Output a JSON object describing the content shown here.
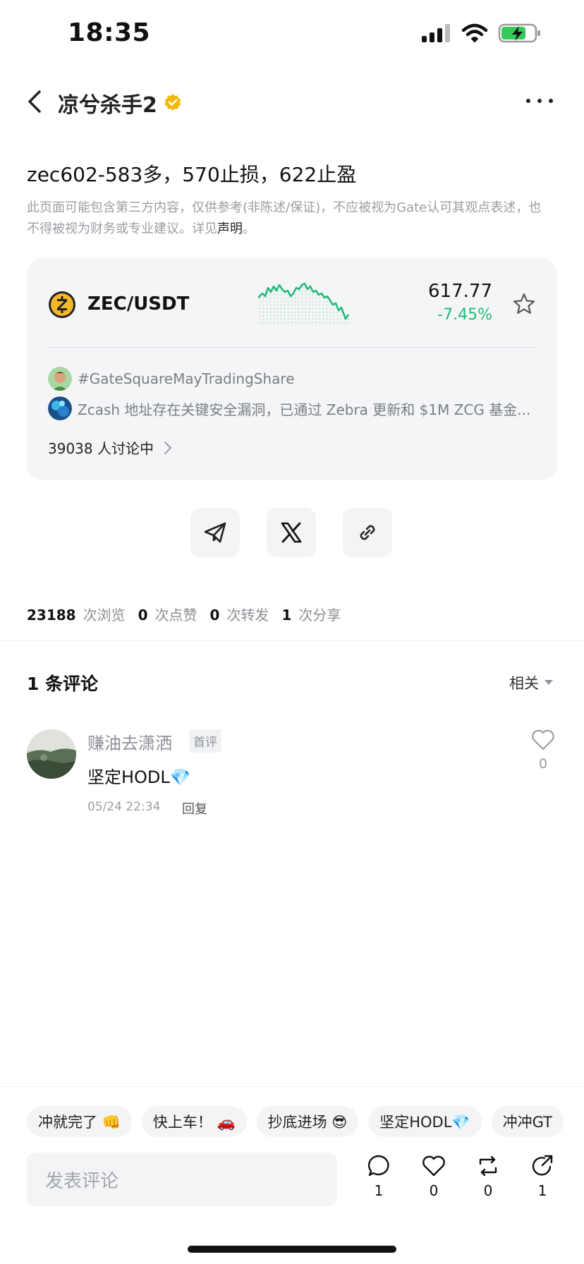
{
  "status_bar": {
    "time": "18:35"
  },
  "header": {
    "author": "凉兮杀手2"
  },
  "post": {
    "title": "zec602-583多，570止损，622止盈",
    "disclaimer": "此页面可能包含第三方内容，仅供参考(非陈述/保证)，不应被视为Gate认可其观点表述，也不得被视为财务或专业建议。详见",
    "disclaimer_link": "声明",
    "disclaimer_end": "。"
  },
  "market": {
    "pair": "ZEC/USDT",
    "price": "617.77",
    "change": "-7.45%",
    "topics": [
      {
        "text": "#GateSquareMayTradingShare"
      },
      {
        "text": "Zcash 地址存在关键安全漏洞，已通过 Zebra 更新和 $1M ZCG 基金..."
      }
    ],
    "discussion": "39038 人讨论中"
  },
  "stats": [
    {
      "num": "23188",
      "label": "次浏览"
    },
    {
      "num": "0",
      "label": "次点赞"
    },
    {
      "num": "0",
      "label": "次转发"
    },
    {
      "num": "1",
      "label": "次分享"
    }
  ],
  "comments": {
    "title": "1 条评论",
    "sort": "相关",
    "items": [
      {
        "user": "赚油去潇洒",
        "badge": "首评",
        "text": "坚定HODL💎",
        "time": "05/24 22:34",
        "reply": "回复",
        "likes": "0"
      }
    ]
  },
  "quick_replies": [
    "冲就完了 👊",
    "快上车！ 🚗",
    "抄底进场 😎",
    "坚定HODL💎",
    "冲冲GT"
  ],
  "bottom_bar": {
    "input_placeholder": "发表评论",
    "comment_count": "1",
    "like_count": "0",
    "repost_count": "0",
    "share_count": "1"
  },
  "colors": {
    "up_down_green": "#1fba77",
    "verified_gold": "#f0b90b",
    "zec_yellow": "#f4b728"
  }
}
